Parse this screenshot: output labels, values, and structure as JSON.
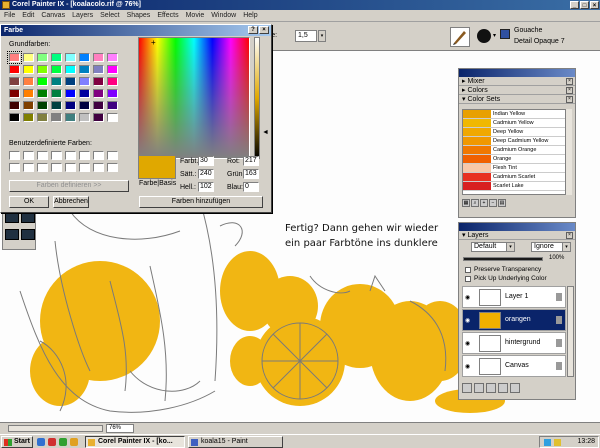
{
  "window": {
    "title": "Corel Painter IX - [koalacolo.rif @ 76%]"
  },
  "menu": [
    "File",
    "Edit",
    "Canvas",
    "Layers",
    "Select",
    "Shapes",
    "Effects",
    "Movie",
    "Window",
    "Help"
  ],
  "property_bar": {
    "feature_label": "Feature:",
    "feature_value": "1,5",
    "brush_category": "Gouache",
    "brush_variant": "Detail Opaque 7"
  },
  "color_dialog": {
    "title": "Farbe",
    "basic_colors_label": "Grundfarben:",
    "custom_colors_label": "Benutzerdefinierte Farben:",
    "define_button": "Farben definieren >>",
    "ok_button": "OK",
    "cancel_button": "Abbrechen",
    "add_button": "Farben hinzufügen",
    "preview_label": "Farbe|Basis",
    "hue_label": "Farbt.:",
    "hue": "30",
    "sat_label": "Sätt.:",
    "sat": "240",
    "lum_label": "Hell.:",
    "lum": "102",
    "red_label": "Rot:",
    "red": "217",
    "green_label": "Grün:",
    "green": "163",
    "blue_label": "Blau:",
    "blue": "0",
    "basic_colors": [
      "#ff8080",
      "#ffff80",
      "#80ff80",
      "#00ff80",
      "#80ffff",
      "#0080ff",
      "#ff80c0",
      "#ff80ff",
      "#ff0000",
      "#ffff00",
      "#80ff00",
      "#00ff40",
      "#00ffff",
      "#0080c0",
      "#8080c0",
      "#ff00ff",
      "#804040",
      "#ff8040",
      "#00ff00",
      "#008080",
      "#004080",
      "#8080ff",
      "#800040",
      "#ff0080",
      "#800000",
      "#ff8000",
      "#008000",
      "#008040",
      "#0000ff",
      "#0000a0",
      "#800080",
      "#8000ff",
      "#400000",
      "#804000",
      "#004000",
      "#004040",
      "#000080",
      "#000040",
      "#400040",
      "#400080",
      "#000000",
      "#808000",
      "#808040",
      "#808080",
      "#408080",
      "#c0c0c0",
      "#400040",
      "#ffffff"
    ],
    "selected_basic_index": 0
  },
  "palettes": {
    "title_bar": "",
    "mixer_label": "Mixer",
    "colors_label": "Colors",
    "color_sets_label": "Color Sets",
    "color_sets": [
      {
        "name": "Indian Yellow",
        "color": "#e8a000"
      },
      {
        "name": "Cadmium Yellow",
        "color": "#f0b800"
      },
      {
        "name": "Deep Yellow",
        "color": "#f0a800"
      },
      {
        "name": "Deep Cadmium Yellow",
        "color": "#f09800"
      },
      {
        "name": "Cadmium Orange",
        "color": "#f07800"
      },
      {
        "name": "Orange",
        "color": "#f06000"
      },
      {
        "name": "Flesh Tint",
        "color": "#f8c8a8"
      },
      {
        "name": "Cadmium Scarlet",
        "color": "#e83020"
      },
      {
        "name": "Scarlet Lake",
        "color": "#d82020"
      }
    ]
  },
  "layers": {
    "title": "Layers",
    "composite_method": "Default",
    "composite_depth": "Ignore",
    "opacity": "100%",
    "preserve_transparency": "Preserve Transparency",
    "pick_up_color": "Pick Up Underlying Color",
    "items": [
      {
        "name": "Layer 1",
        "selected": false
      },
      {
        "name": "orangen",
        "selected": true
      },
      {
        "name": "hintergrund",
        "selected": false
      },
      {
        "name": "Canvas",
        "selected": false
      }
    ]
  },
  "canvas": {
    "note_line1": "Fertig? Dann gehen wir wieder",
    "note_line2": "ein paar Farbtöne ins dunklere",
    "paint_color": "#f0b000"
  },
  "status": {
    "zoom": "76%"
  },
  "taskbar": {
    "start": "Start",
    "tasks": [
      {
        "label": "Corel Painter IX - [ko...",
        "active": true
      },
      {
        "label": "koala15 - Paint",
        "active": false
      }
    ],
    "clock": "13:28"
  }
}
